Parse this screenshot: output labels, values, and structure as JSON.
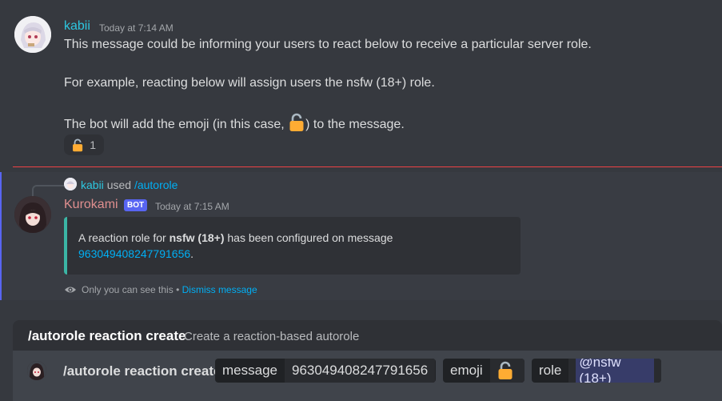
{
  "colors": {
    "background": "#36393f",
    "kabii_name": "#2dc7e0",
    "kurokami_name": "#e08f8f",
    "bot_badge": "#5865f2",
    "divider": "#ed4245",
    "link": "#00aff4",
    "embed_border": "#3bb5a5"
  },
  "message1": {
    "author": "kabii",
    "timestamp": "Today at 7:14 AM",
    "line1": "This message could be informing your users to react below to receive a particular server role.",
    "line2": "For example, reacting below will assign users the nsfw (18+) role.",
    "line3_prefix": "The bot will add the emoji (in this case, ",
    "line3_suffix": ") to the message.",
    "emoji_icon": "open-lock-icon",
    "reaction": {
      "icon": "open-lock-icon",
      "count": "1"
    }
  },
  "message2": {
    "reply": {
      "user": "kabii",
      "verb": "used",
      "command": "/autorole"
    },
    "author": "Kurokami",
    "badge": "BOT",
    "timestamp": "Today at 7:15 AM",
    "embed": {
      "text_prefix": "A reaction role for ",
      "role_bold": "nsfw (18+)",
      "text_middle": " has been configured on message",
      "message_id": "963049408247791656",
      "text_end": "."
    },
    "ephemeral": {
      "icon": "eye-icon",
      "text": "Only you can see this",
      "separator": " • ",
      "dismiss": "Dismiss message"
    }
  },
  "command_hint": {
    "command": "/autorole reaction create",
    "description": "Create a reaction-based autorole"
  },
  "command_input": {
    "command": "/autorole reaction create",
    "options": [
      {
        "key": "message",
        "value": "963049408247791656"
      },
      {
        "key": "emoji",
        "value_icon": "open-lock-icon"
      },
      {
        "key": "role",
        "value": "@nsfw (18+)"
      }
    ]
  }
}
